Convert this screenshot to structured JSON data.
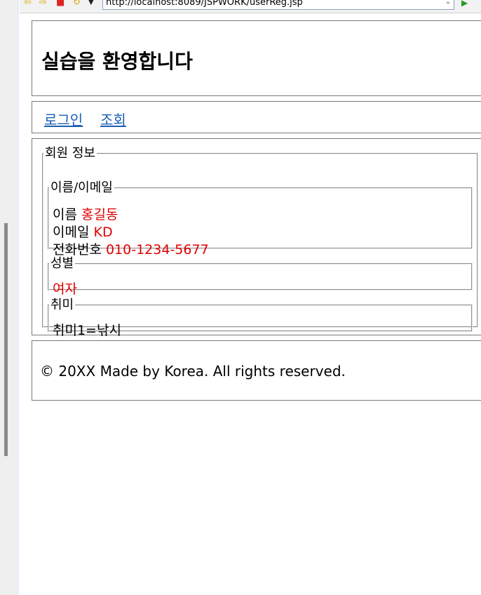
{
  "browser": {
    "url": "http://localhost:8089/JSPWORK/userReg.jsp",
    "icons": {
      "back": "back-arrow-icon",
      "forward": "forward-arrow-icon",
      "stop": "stop-icon",
      "refresh": "refresh-icon",
      "menu": "dropdown-icon",
      "go": "go-icon"
    }
  },
  "header": {
    "title": "실습을 환영합니다"
  },
  "nav": {
    "login": "로그인",
    "search": "조회"
  },
  "member_info": {
    "legend": "회원 정보",
    "name_email": {
      "legend": "이름/이메일",
      "name_label": "이름",
      "name_value": "홍길동",
      "email_label": "이메일",
      "email_value": "KD",
      "phone_label": "전화번호",
      "phone_value": "010-1234-5677"
    },
    "gender": {
      "legend": "성별",
      "value": "여자"
    },
    "hobby": {
      "legend": "취미",
      "text": "취미1=낚시"
    }
  },
  "footer": {
    "text": "© 20XX Made by Korea. All rights reserved."
  },
  "colors": {
    "value_text": "#e00000",
    "link": "#1a5fb4",
    "border": "#7a7a7a"
  }
}
